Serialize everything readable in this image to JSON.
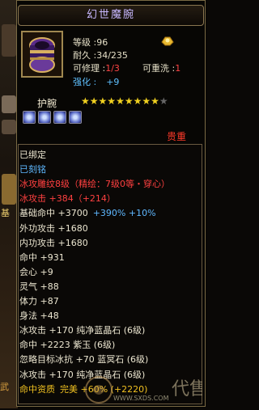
{
  "left_strip": {
    "label": "基",
    "bottom_text": "武"
  },
  "tooltip": {
    "title": "幻世魔腕",
    "stats": {
      "level": "等级 :96",
      "durability": "耐久 :34/235",
      "repairable_label": "可修理 :",
      "repairable_value": "1/3",
      "rewash_label": "可重洗 :",
      "rewash_value": "1",
      "enhance_label": "强化 :",
      "enhance_value": "+9"
    },
    "slot_type": "护腕",
    "stars_filled": 9,
    "stars_total": 10,
    "gems": [
      "gem-1",
      "gem-2",
      "gem-3",
      "gem-4"
    ],
    "price_label": "贵重",
    "details": [
      {
        "text": "已绑定",
        "color": "white"
      },
      {
        "text": "已刻铭",
        "color": "blue"
      },
      {
        "text": "冰攻雕纹8级（精绘：7级0等・穿心）",
        "color": "red"
      },
      {
        "text": "冰攻击 +384（+214）",
        "color": "red"
      },
      {
        "text": "基础命中 +3700",
        "extra": "+390% +10%",
        "color": "white"
      },
      {
        "text": "外功攻击 +1680",
        "color": "white"
      },
      {
        "text": "内功攻击 +1680",
        "color": "white"
      },
      {
        "text": "命中 +931",
        "color": "white"
      },
      {
        "text": "会心 +9",
        "color": "white"
      },
      {
        "text": "灵气 +88",
        "color": "white"
      },
      {
        "text": "体力 +87",
        "color": "white"
      },
      {
        "text": "身法 +48",
        "color": "white"
      },
      {
        "text": "冰攻击 +170 纯净蓝晶石 (6级)",
        "color": "white"
      },
      {
        "text": "命中 +2223 紫玉 (6级)",
        "color": "white"
      },
      {
        "text": "忽略目标冰抗 +70 蓝冥石 (6级)",
        "color": "white"
      },
      {
        "text": "冰攻击 +170 纯净蓝晶石 (6级)",
        "color": "white"
      },
      {
        "text": "命中资质",
        "extra": "完美 +60% (+2220)",
        "color": "gold"
      }
    ]
  },
  "watermark": {
    "text": "WWW.SXDS.COM"
  },
  "colors": {
    "accent_red": "#ff4040",
    "accent_blue": "#5fb8ff",
    "title_color": "#c8b8ff",
    "star_color": "#f0d020"
  }
}
